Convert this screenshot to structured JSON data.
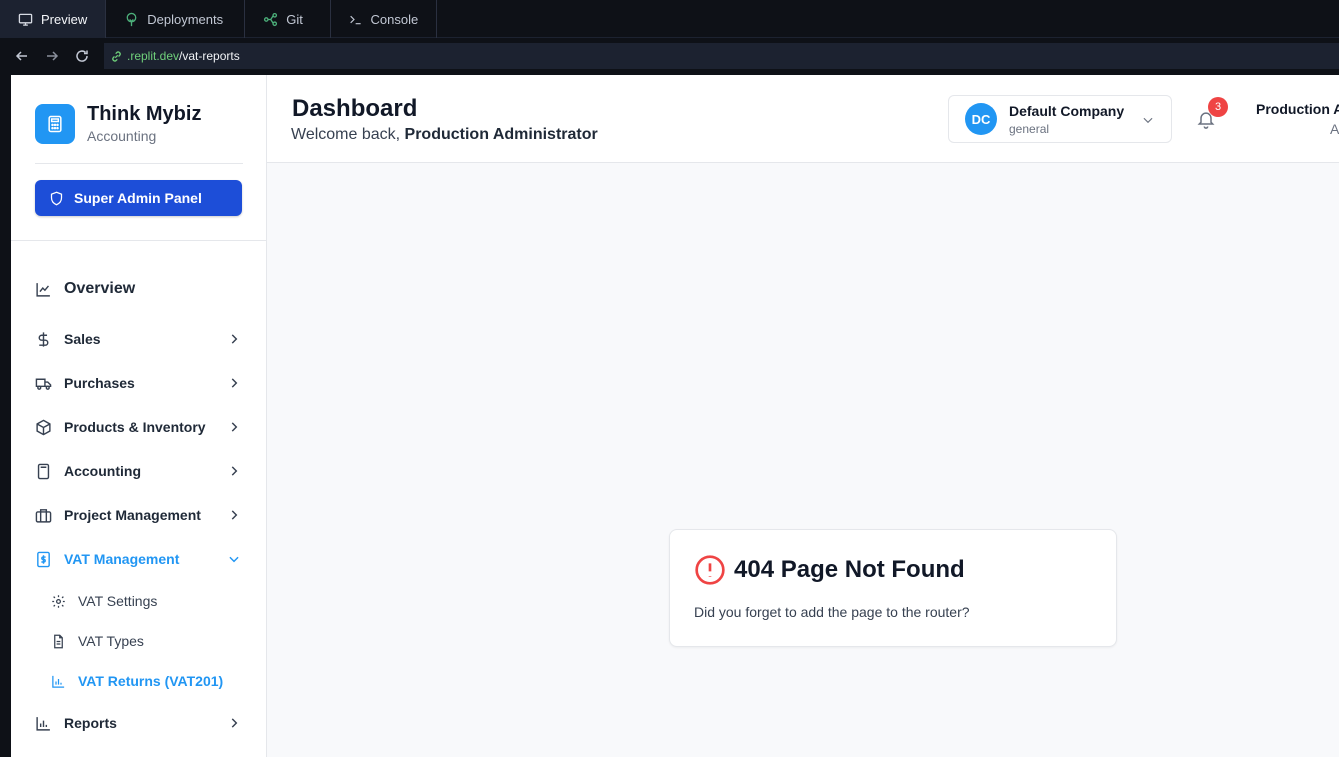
{
  "ide": {
    "tabs": [
      {
        "label": "Preview",
        "icon": "monitor-icon"
      },
      {
        "label": "Deployments",
        "icon": "deploy-icon"
      },
      {
        "label": "Git",
        "icon": "git-icon"
      },
      {
        "label": "Console",
        "icon": "console-icon"
      }
    ],
    "url": {
      "host": ".replit.dev",
      "path": "/vat-reports"
    }
  },
  "sidebar": {
    "brand_title": "Think Mybiz",
    "brand_subtitle": "Accounting",
    "admin_button": "Super Admin Panel",
    "nav": [
      {
        "label": "Overview",
        "icon": "line-chart-icon"
      },
      {
        "label": "Sales",
        "icon": "dollar-icon"
      },
      {
        "label": "Purchases",
        "icon": "truck-icon"
      },
      {
        "label": "Products & Inventory",
        "icon": "box-icon"
      },
      {
        "label": "Accounting",
        "icon": "calculator-icon"
      },
      {
        "label": "Project Management",
        "icon": "briefcase-icon"
      },
      {
        "label": "VAT Management",
        "icon": "receipt-dollar-icon"
      },
      {
        "label": "Reports",
        "icon": "bar-chart-icon"
      }
    ],
    "vat_sub": [
      {
        "label": "VAT Settings",
        "icon": "gear-icon"
      },
      {
        "label": "VAT Types",
        "icon": "file-icon"
      },
      {
        "label": "VAT Returns (VAT201)",
        "icon": "bar-chart-icon"
      }
    ]
  },
  "header": {
    "title": "Dashboard",
    "welcome_prefix": "Welcome back, ",
    "welcome_user": "Production Administrator",
    "company": {
      "initials": "DC",
      "name": "Default Company",
      "type": "general"
    },
    "notifications_count": "3",
    "user_name": "Production Administrator",
    "user_role": "Admin"
  },
  "error": {
    "title": "404 Page Not Found",
    "message": "Did you forget to add the page to the router?"
  },
  "colors": {
    "primary": "#2196f3",
    "admin_button": "#1d4ed8",
    "error": "#ef4444"
  }
}
